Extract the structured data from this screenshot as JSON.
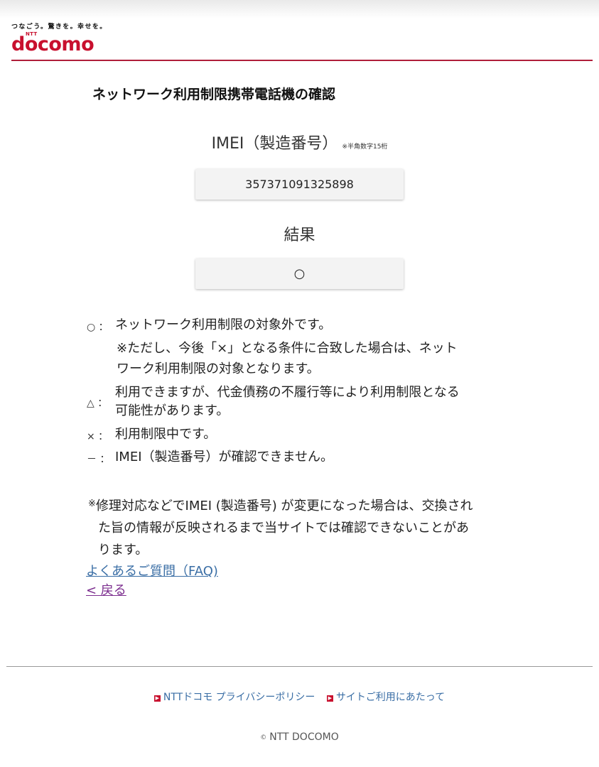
{
  "header": {
    "tagline": "つなごう。驚きを。幸せを。",
    "brand_small": "NTT",
    "logo": "docomo",
    "brand_color": "#c8102e"
  },
  "page": {
    "title": "ネットワーク利用制限携帯電話機の確認"
  },
  "imei": {
    "label": "IMEI（製造番号）",
    "note": "※半角数字15桁",
    "value": "357371091325898"
  },
  "result": {
    "label": "結果",
    "value": "○"
  },
  "legend": [
    {
      "symbol": "○ ：",
      "lines": [
        "ネットワーク利用制限の対象外です。",
        "※ただし、今後「×」となる条件に合致した場合は、ネット",
        "ワーク利用制限の対象となります。"
      ]
    },
    {
      "symbol": "△ ：",
      "lines": [
        "利用できますが、代金債務の不履行等により利用制限となる",
        "可能性があります。"
      ]
    },
    {
      "symbol": "× ：",
      "lines": [
        "利用制限中です。"
      ]
    },
    {
      "symbol": "－ ：",
      "lines": [
        "IMEI（製造番号）が確認できません。"
      ]
    }
  ],
  "note": {
    "asterisk": "※",
    "line1": "修理対応などでIMEI (製造番号) が変更になった場合は、交換され",
    "line2": "た旨の情報が反映されるまで当サイトでは確認できないことがあ",
    "line3": "ります。"
  },
  "links": {
    "faq": "よくあるご質問（FAQ)",
    "back": "< 戻る"
  },
  "footer": {
    "privacy": "NTTドコモ プライバシーポリシー",
    "terms": "サイトご利用にあたって",
    "copyright_symbol": "©",
    "copyright": "NTT DOCOMO",
    "link_color": "#3a6ea5",
    "arrow_icon": "arrow-box-icon"
  }
}
